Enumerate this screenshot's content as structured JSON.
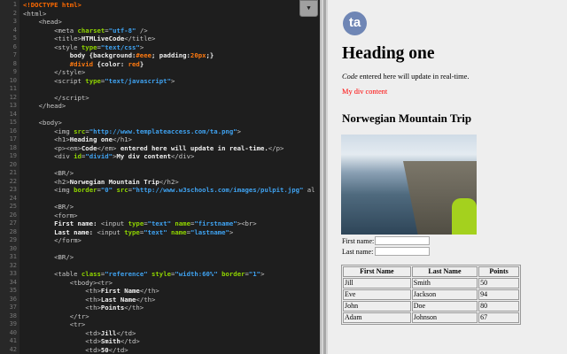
{
  "editor": {
    "menu_icon": "triangle-down-icon",
    "lines": [
      [
        [
          "d",
          "<!DOCTYPE html>"
        ]
      ],
      [
        [
          "t",
          "<html>"
        ]
      ],
      [
        [
          "t",
          "    <head>"
        ]
      ],
      [
        [
          "t",
          "        <meta "
        ],
        [
          "a",
          "charset"
        ],
        [
          "t",
          "="
        ],
        [
          "s",
          "\"utf-8\""
        ],
        [
          "t",
          " />"
        ]
      ],
      [
        [
          "t",
          "        <title>"
        ],
        [
          "x",
          "HTMLiveCode"
        ],
        [
          "t",
          "</title>"
        ]
      ],
      [
        [
          "t",
          "        <style "
        ],
        [
          "a",
          "type"
        ],
        [
          "t",
          "="
        ],
        [
          "s",
          "\"text/css\""
        ],
        [
          "t",
          ">"
        ]
      ],
      [
        [
          "c",
          "            body {background:"
        ],
        [
          "o",
          "#eee"
        ],
        [
          "c",
          "; padding:"
        ],
        [
          "o",
          "20px"
        ],
        [
          "c",
          ";}"
        ]
      ],
      [
        [
          "o",
          "            #divid"
        ],
        [
          "c",
          " {color: "
        ],
        [
          "o",
          "red"
        ],
        [
          "c",
          "}"
        ]
      ],
      [
        [
          "t",
          "        </style>"
        ]
      ],
      [
        [
          "t",
          "        <script "
        ],
        [
          "a",
          "type"
        ],
        [
          "t",
          "="
        ],
        [
          "s",
          "\"text/javascript\""
        ],
        [
          "t",
          ">"
        ]
      ],
      [],
      [
        [
          "t",
          "        </script>"
        ]
      ],
      [
        [
          "t",
          "    </head>"
        ]
      ],
      [],
      [
        [
          "t",
          "    <body>"
        ]
      ],
      [
        [
          "t",
          "        <img "
        ],
        [
          "a",
          "src"
        ],
        [
          "t",
          "="
        ],
        [
          "s",
          "\"http://www.templateaccess.com/ta.png\""
        ],
        [
          "t",
          ">"
        ]
      ],
      [
        [
          "t",
          "        <h1>"
        ],
        [
          "x",
          "Heading one"
        ],
        [
          "t",
          "</h1>"
        ]
      ],
      [
        [
          "t",
          "        <p><em>"
        ],
        [
          "x",
          "Code"
        ],
        [
          "t",
          "</em>"
        ],
        [
          "x",
          " entered here will update in real-time."
        ],
        [
          "t",
          "</p>"
        ]
      ],
      [
        [
          "t",
          "        <div "
        ],
        [
          "a",
          "id"
        ],
        [
          "t",
          "="
        ],
        [
          "s",
          "\"divid\""
        ],
        [
          "t",
          ">"
        ],
        [
          "x",
          "My div content"
        ],
        [
          "t",
          "</div>"
        ]
      ],
      [],
      [
        [
          "t",
          "        <BR/>"
        ]
      ],
      [
        [
          "t",
          "        <h2>"
        ],
        [
          "x",
          "Norwegian Mountain Trip"
        ],
        [
          "t",
          "</h2>"
        ]
      ],
      [
        [
          "t",
          "        <img "
        ],
        [
          "a",
          "border"
        ],
        [
          "t",
          "="
        ],
        [
          "s",
          "\"0\""
        ],
        [
          "t",
          " "
        ],
        [
          "a",
          "src"
        ],
        [
          "t",
          "="
        ],
        [
          "s",
          "\"http://www.w3schools.com/images/pulpit.jpg\""
        ],
        [
          "t",
          " al"
        ]
      ],
      [],
      [
        [
          "t",
          "        <BR/>"
        ]
      ],
      [
        [
          "t",
          "        <form>"
        ]
      ],
      [
        [
          "x",
          "        First name: "
        ],
        [
          "t",
          "<input "
        ],
        [
          "a",
          "type"
        ],
        [
          "t",
          "="
        ],
        [
          "s",
          "\"text\""
        ],
        [
          "t",
          " "
        ],
        [
          "a",
          "name"
        ],
        [
          "t",
          "="
        ],
        [
          "s",
          "\"firstname\""
        ],
        [
          "t",
          "><br>"
        ]
      ],
      [
        [
          "x",
          "        Last name: "
        ],
        [
          "t",
          "<input "
        ],
        [
          "a",
          "type"
        ],
        [
          "t",
          "="
        ],
        [
          "s",
          "\"text\""
        ],
        [
          "t",
          " "
        ],
        [
          "a",
          "name"
        ],
        [
          "t",
          "="
        ],
        [
          "s",
          "\"lastname\""
        ],
        [
          "t",
          ">"
        ]
      ],
      [
        [
          "t",
          "        </form>"
        ]
      ],
      [],
      [
        [
          "t",
          "        <BR/>"
        ]
      ],
      [],
      [
        [
          "t",
          "        <table "
        ],
        [
          "a",
          "class"
        ],
        [
          "t",
          "="
        ],
        [
          "s",
          "\"reference\""
        ],
        [
          "t",
          " "
        ],
        [
          "a",
          "style"
        ],
        [
          "t",
          "="
        ],
        [
          "s",
          "\"width:60%\""
        ],
        [
          "t",
          " "
        ],
        [
          "a",
          "border"
        ],
        [
          "t",
          "="
        ],
        [
          "s",
          "\"1\""
        ],
        [
          "t",
          ">"
        ]
      ],
      [
        [
          "t",
          "            <tbody><tr>"
        ]
      ],
      [
        [
          "t",
          "                <th>"
        ],
        [
          "x",
          "First Name"
        ],
        [
          "t",
          "</th>"
        ]
      ],
      [
        [
          "t",
          "                <th>"
        ],
        [
          "x",
          "Last Name"
        ],
        [
          "t",
          "</th>"
        ]
      ],
      [
        [
          "t",
          "                <th>"
        ],
        [
          "x",
          "Points"
        ],
        [
          "t",
          "</th>"
        ]
      ],
      [
        [
          "t",
          "            </tr>"
        ]
      ],
      [
        [
          "t",
          "            <tr>"
        ]
      ],
      [
        [
          "t",
          "                <td>"
        ],
        [
          "x",
          "Jill"
        ],
        [
          "t",
          "</td>"
        ]
      ],
      [
        [
          "t",
          "                <td>"
        ],
        [
          "x",
          "Smith"
        ],
        [
          "t",
          "</td>"
        ]
      ],
      [
        [
          "t",
          "                <td>"
        ],
        [
          "x",
          "50"
        ],
        [
          "t",
          "</td>"
        ]
      ]
    ]
  },
  "preview": {
    "logo_text": "ta",
    "heading": "Heading one",
    "para_em": "Code",
    "para_rest": " entered here will update in real-time.",
    "div_text": "My div content",
    "h2": "Norwegian Mountain Trip",
    "form": {
      "first_label": "First name:",
      "last_label": "Last name:",
      "first_value": "",
      "last_value": ""
    },
    "table": {
      "headers": [
        "First Name",
        "Last Name",
        "Points"
      ],
      "rows": [
        [
          "Jill",
          "Smith",
          "50"
        ],
        [
          "Eve",
          "Jackson",
          "94"
        ],
        [
          "John",
          "Doe",
          "80"
        ],
        [
          "Adam",
          "Johnson",
          "67"
        ]
      ]
    }
  }
}
